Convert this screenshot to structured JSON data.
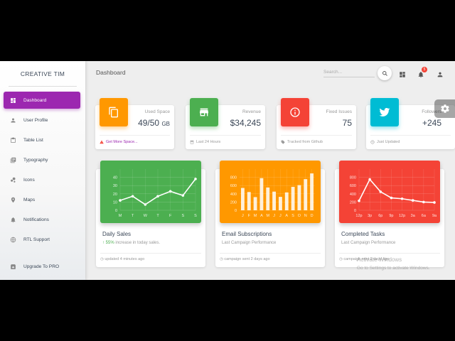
{
  "sidebar": {
    "brand": "CREATIVE TIM",
    "items": [
      {
        "label": "Dashboard",
        "icon": "dashboard-icon"
      },
      {
        "label": "User Profile",
        "icon": "person-icon"
      },
      {
        "label": "Table List",
        "icon": "clipboard-icon"
      },
      {
        "label": "Typography",
        "icon": "library-books-icon"
      },
      {
        "label": "Icons",
        "icon": "bubble-chart-icon"
      },
      {
        "label": "Maps",
        "icon": "location-icon"
      },
      {
        "label": "Notifications",
        "icon": "bell-icon"
      },
      {
        "label": "RTL Support",
        "icon": "language-icon"
      },
      {
        "label": "Upgrade To PRO",
        "icon": "unarchive-icon"
      }
    ]
  },
  "topbar": {
    "title": "Dashboard",
    "search_placeholder": "Search...",
    "notification_count": "5"
  },
  "stats": [
    {
      "label": "Used Space",
      "value": "49/50",
      "unit": "GB",
      "footer": "Get More Space...",
      "color": "#ff9800",
      "icon": "content-copy-icon",
      "footer_icon": "warning-icon"
    },
    {
      "label": "Revenue",
      "value": "$34,245",
      "unit": "",
      "footer": "Last 24 Hours",
      "color": "#4caf50",
      "icon": "store-icon",
      "footer_icon": "date-range-icon"
    },
    {
      "label": "Fixed Issues",
      "value": "75",
      "unit": "",
      "footer": "Tracked from Github",
      "color": "#f44336",
      "icon": "info-outline-icon",
      "footer_icon": "local-offer-icon"
    },
    {
      "label": "Followers",
      "value": "+245",
      "unit": "",
      "footer": "Just Updated",
      "color": "#00bcd4",
      "icon": "twitter-icon",
      "footer_icon": "update-icon"
    }
  ],
  "charts": [
    {
      "title": "Daily Sales",
      "subtitle_prefix": "55%",
      "subtitle": " increase in today sales.",
      "footer": "updated 4 minutes ago",
      "color": "#4caf50"
    },
    {
      "title": "Email Subscriptions",
      "subtitle": "Last Campaign Performance",
      "footer": "campaign sent 2 days ago",
      "color": "#ff9800"
    },
    {
      "title": "Completed Tasks",
      "subtitle": "Last Campaign Performance",
      "footer": "campaign sent 2 days ago",
      "color": "#f44336"
    }
  ],
  "chart_data": [
    {
      "type": "line",
      "categories": [
        "M",
        "T",
        "W",
        "T",
        "F",
        "S",
        "S"
      ],
      "values": [
        12,
        17,
        7,
        17,
        23,
        18,
        38
      ],
      "yticks": [
        "0",
        "10",
        "20",
        "30",
        "40"
      ],
      "ylim": [
        0,
        50
      ]
    },
    {
      "type": "bar",
      "categories": [
        "J",
        "F",
        "M",
        "A",
        "M",
        "J",
        "J",
        "A",
        "S",
        "O",
        "N",
        "D"
      ],
      "values": [
        542,
        443,
        320,
        780,
        553,
        453,
        326,
        434,
        568,
        610,
        756,
        895
      ],
      "yticks": [
        "0",
        "200",
        "400",
        "600",
        "800"
      ],
      "ylim": [
        0,
        1000
      ]
    },
    {
      "type": "line",
      "categories": [
        "12p",
        "3p",
        "6p",
        "9p",
        "12p",
        "3a",
        "6a",
        "9a"
      ],
      "values": [
        230,
        750,
        450,
        300,
        280,
        240,
        200,
        190
      ],
      "yticks": [
        "0",
        "200",
        "400",
        "600",
        "800"
      ],
      "ylim": [
        0,
        1000
      ]
    }
  ],
  "watermark": {
    "line1": "Activate Windows",
    "line2": "Go to Settings to activate Windows."
  }
}
